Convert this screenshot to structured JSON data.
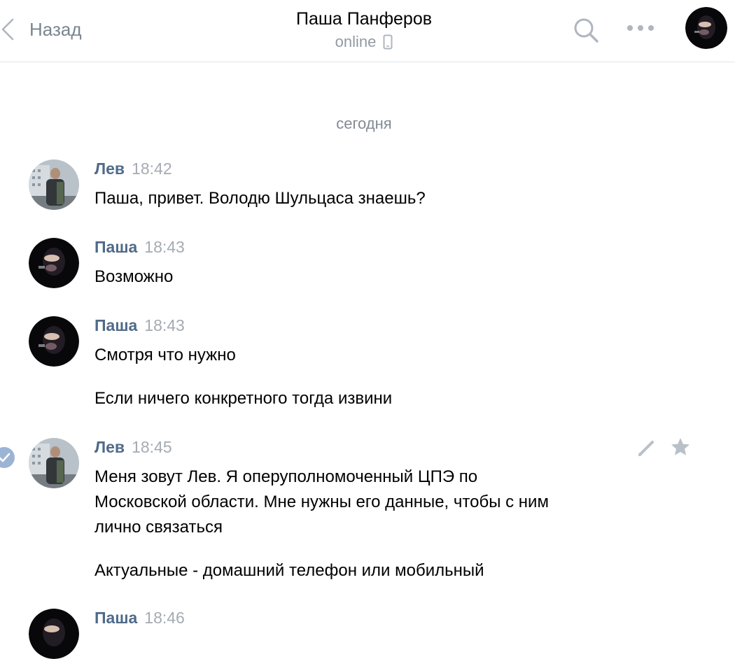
{
  "header": {
    "back_label": "Назад",
    "title": "Паша Панферов",
    "status": "online"
  },
  "date_separator": "сегодня",
  "messages": [
    {
      "author": "Лев",
      "time": "18:42",
      "lines": [
        "Паша, привет. Володю Шульцаса знаешь?"
      ]
    },
    {
      "author": "Паша",
      "time": "18:43",
      "lines": [
        "Возможно"
      ]
    },
    {
      "author": "Паша",
      "time": "18:43",
      "lines": [
        "Смотря что нужно",
        "Если ничего конкретного тогда извини"
      ]
    },
    {
      "author": "Лев",
      "time": "18:45",
      "lines": [
        "Меня зовут Лев. Я оперуполномоченный ЦПЭ по",
        "Московской области. Мне нужны его данные, чтобы с ним",
        "лично связаться",
        "Актуальные - домашний телефон или мобильный"
      ]
    },
    {
      "author": "Паша",
      "time": "18:46",
      "lines": []
    }
  ],
  "colors": {
    "author_name": "#4f6a89",
    "time": "#a4abb3",
    "secondary": "#828a93",
    "icon_gray": "#aeb6bf",
    "check_blue": "#9cb4d4"
  },
  "icons": [
    "back-chevron-icon",
    "phone-icon",
    "search-icon",
    "more-icon",
    "check-icon",
    "edit-icon",
    "star-icon"
  ]
}
